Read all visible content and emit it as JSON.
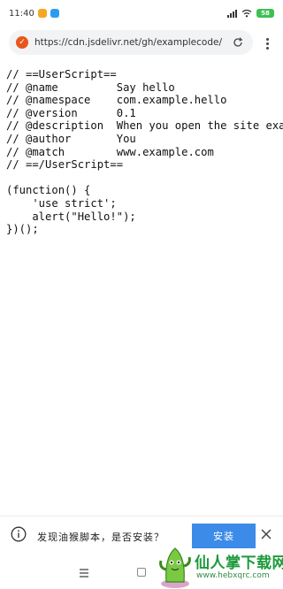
{
  "status_bar": {
    "time": "11:40",
    "battery": "58"
  },
  "browser": {
    "url": "https://cdn.jsdelivr.net/gh/examplecode/"
  },
  "code_lines": [
    "// ==UserScript==",
    "// @name         Say hello",
    "// @namespace    com.example.hello",
    "// @version      0.1",
    "// @description  When you open the site example.com it says \"Hello\"",
    "// @author       You",
    "// @match        www.example.com",
    "// ==/UserScript==",
    "",
    "(function() {",
    "    'use strict';",
    "    alert(\"Hello!\");",
    "})();"
  ],
  "install_prompt": {
    "message": "发现油猴脚本，是否安装？",
    "install_label": "安装"
  },
  "watermark": {
    "title": "仙人掌下载网",
    "url": "www.hebxqrc.com"
  },
  "colors": {
    "accent": "#3d8be8",
    "brand_badge": "#e8561c",
    "watermark_green": "#1c9a3a"
  },
  "icons": [
    "shield-icon",
    "reload-icon",
    "more-vert-icon",
    "info-icon",
    "close-icon",
    "wifi-icon",
    "signal-icon",
    "battery-icon"
  ]
}
